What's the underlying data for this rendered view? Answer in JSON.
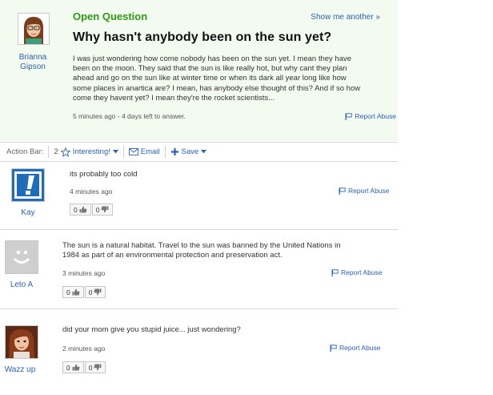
{
  "question": {
    "label": "Open Question",
    "show_another": "Show me another »",
    "title": "Why hasn't anybody been on the sun yet?",
    "author": "Brianna Gipson",
    "body_lines": [
      "I was just wondering how come nobody has been on the sun yet. I mean they have",
      "been on the moon. They said that the sun is like really hot, but why cant they plan",
      "ahead and go on the sun like at winter time or when its dark all year long like how",
      "some places in anartica are? I mean, has anybody else thought of this? And if so how",
      "come they havent yet? I mean they're the rocket scientists..."
    ],
    "meta": "5 minutes ago - 4 days left to answer.",
    "report": "Report Abuse"
  },
  "action_bar": {
    "label": "Action Bar:",
    "interesting_count": "2",
    "interesting": "Interesting!",
    "email": "Email",
    "save": "Save"
  },
  "answers": [
    {
      "author": "Kay",
      "text": "its probably too cold",
      "text2": "",
      "time": "4 minutes ago",
      "report": "Report Abuse",
      "up": "0",
      "down": "0"
    },
    {
      "author": "Leto A",
      "text": "The sun is a natural habitat. Travel to the sun was banned by the United Nations in",
      "text2": "1984 as part of an environmental protection and preservation act.",
      "time": "3 minutes ago",
      "report": "Report Abuse",
      "up": "0",
      "down": "0"
    },
    {
      "author": "Wazz up",
      "text": "did your mom give you stupid juice... just wondering?",
      "text2": "",
      "time": "2 minutes ago",
      "report": "Report Abuse",
      "up": "0",
      "down": "0"
    }
  ],
  "colors": {
    "accent_green": "#2d9b16",
    "link_blue": "#2a62b5",
    "question_bg": "#f3faef"
  },
  "icons": [
    "star-icon",
    "envelope-icon",
    "plus-icon",
    "chevron-down-icon",
    "flag-icon",
    "thumbs-up-icon",
    "thumbs-down-icon"
  ]
}
